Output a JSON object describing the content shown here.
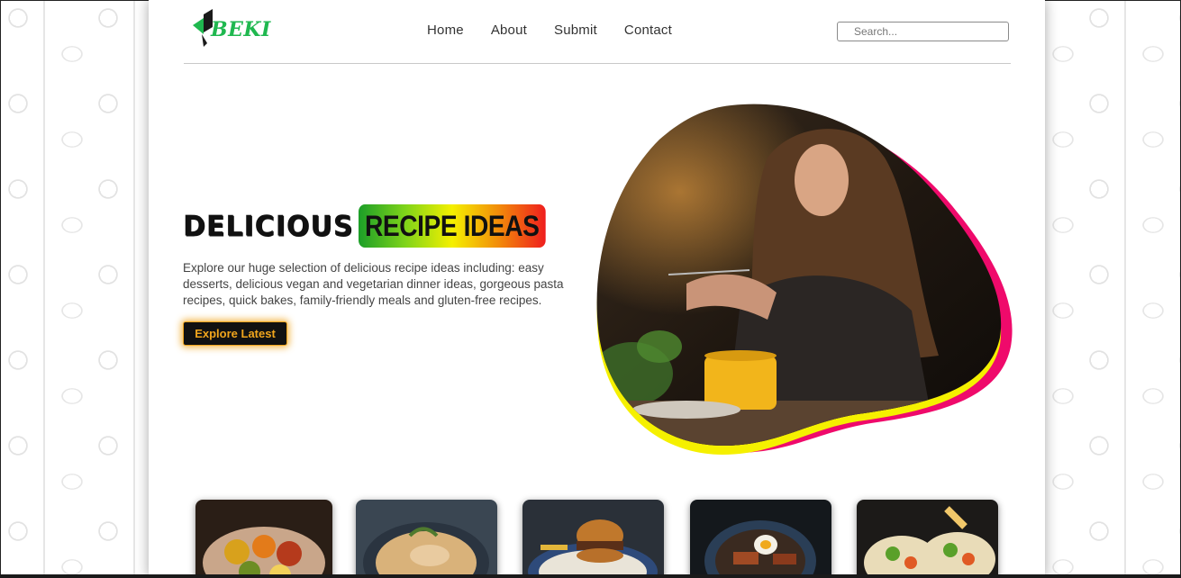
{
  "brand": {
    "logo_text": "BEKI",
    "color": "#1fb84f"
  },
  "nav": {
    "items": [
      "Home",
      "About",
      "Submit",
      "Contact"
    ]
  },
  "search": {
    "placeholder": "Search..."
  },
  "hero": {
    "title_word1": "DELICIOUS",
    "title_word2": "RECIPE IDEAS",
    "description": "Explore our huge selection of delicious recipe ideas including: easy desserts, delicious vegan and vegetarian dinner ideas, gorgeous pasta recipes, quick bakes, family-friendly meals and gluten-free recipes.",
    "cta_label": "Explore Latest",
    "cta_color": "#f0a51d",
    "blob_accent_colors": [
      "#ef0a6b",
      "#f5f000"
    ]
  },
  "recipe_cards": [
    {
      "name": "spice-platter"
    },
    {
      "name": "noodle-soup"
    },
    {
      "name": "burger"
    },
    {
      "name": "ramen-bowl"
    },
    {
      "name": "tacos"
    }
  ]
}
